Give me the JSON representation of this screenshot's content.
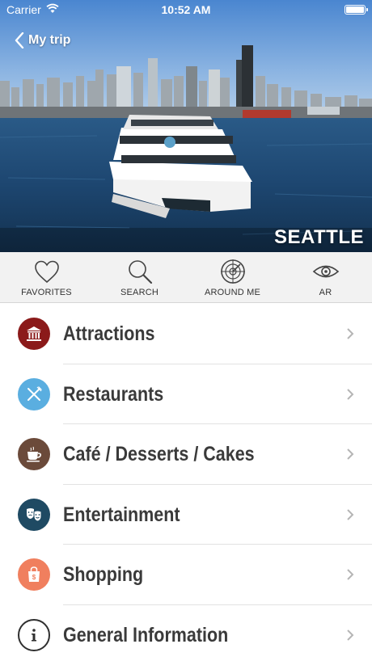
{
  "status_bar": {
    "carrier": "Carrier",
    "time": "10:52 AM"
  },
  "nav": {
    "back_label": "My trip"
  },
  "hero": {
    "city": "SEATTLE"
  },
  "toolbar": {
    "items": [
      {
        "label": "FAVORITES",
        "icon": "heart-icon"
      },
      {
        "label": "SEARCH",
        "icon": "magnifier-icon"
      },
      {
        "label": "AROUND ME",
        "icon": "radar-icon"
      },
      {
        "label": "AR",
        "icon": "eye-icon"
      }
    ]
  },
  "menu": {
    "items": [
      {
        "label": "Attractions",
        "icon": "museum-icon",
        "color": "#8b1a1a"
      },
      {
        "label": "Restaurants",
        "icon": "fork-knife-icon",
        "color": "#5aaee0"
      },
      {
        "label": "Café / Desserts / Cakes",
        "icon": "coffee-cup-icon",
        "color": "#6b4a3a"
      },
      {
        "label": "Entertainment",
        "icon": "theater-masks-icon",
        "color": "#1f4a63"
      },
      {
        "label": "Shopping",
        "icon": "shopping-bag-icon",
        "color": "#f07f5e"
      },
      {
        "label": "General Information",
        "icon": "info-icon",
        "color": "#ffffff"
      }
    ]
  }
}
